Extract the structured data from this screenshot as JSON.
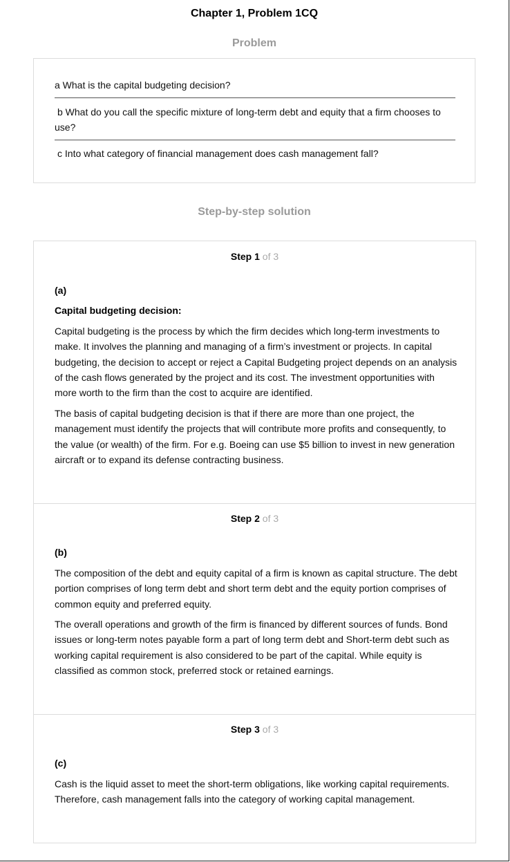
{
  "title": "Chapter 1, Problem 1CQ",
  "problem": {
    "heading": "Problem",
    "questions": [
      "a What is the capital budgeting decision?",
      "b What do you call the specific mixture of long-term debt and equity that a firm chooses to use?",
      "c Into what category of financial management does cash management fall?"
    ]
  },
  "solution": {
    "heading": "Step-by-step solution",
    "steps": [
      {
        "step_word": "Step",
        "number": "1",
        "of_text": "of 3",
        "part": "(a)",
        "subheading": "Capital budgeting decision:",
        "paragraphs": [
          "Capital budgeting is the process by which the firm decides which long-term investments to make. It involves the planning and managing of a firm’s investment or projects. In capital budgeting, the decision to accept or reject a Capital Budgeting project depends on an analysis of the cash flows generated by the project and its cost. The investment opportunities with more worth to the firm than the cost to acquire are identified.",
          "The basis of capital budgeting decision is that if there are more than one project, the management must identify the projects that will contribute more profits and consequently, to the value (or wealth) of the firm. For e.g. Boeing can use $5 billion to invest in new generation aircraft or to expand its defense contracting business."
        ]
      },
      {
        "step_word": "Step",
        "number": "2",
        "of_text": "of 3",
        "part": "(b)",
        "paragraphs": [
          "The composition of the debt and equity capital of a firm is known as capital structure. The debt portion comprises of long term debt and short term debt and the equity portion comprises of common equity and preferred equity.",
          "The overall operations and growth of the firm is financed by different sources of funds. Bond issues or long-term notes payable form a part of long term debt and Short-term debt such as working capital requirement is also considered to be part of the capital. While equity is classified as common stock, preferred stock or retained earnings."
        ]
      },
      {
        "step_word": "Step",
        "number": "3",
        "of_text": "of 3",
        "part": "(c)",
        "paragraphs": [
          "Cash is the liquid asset to meet the short-term obligations, like working capital requirements. Therefore, cash management falls into the category of working capital management."
        ]
      }
    ]
  }
}
